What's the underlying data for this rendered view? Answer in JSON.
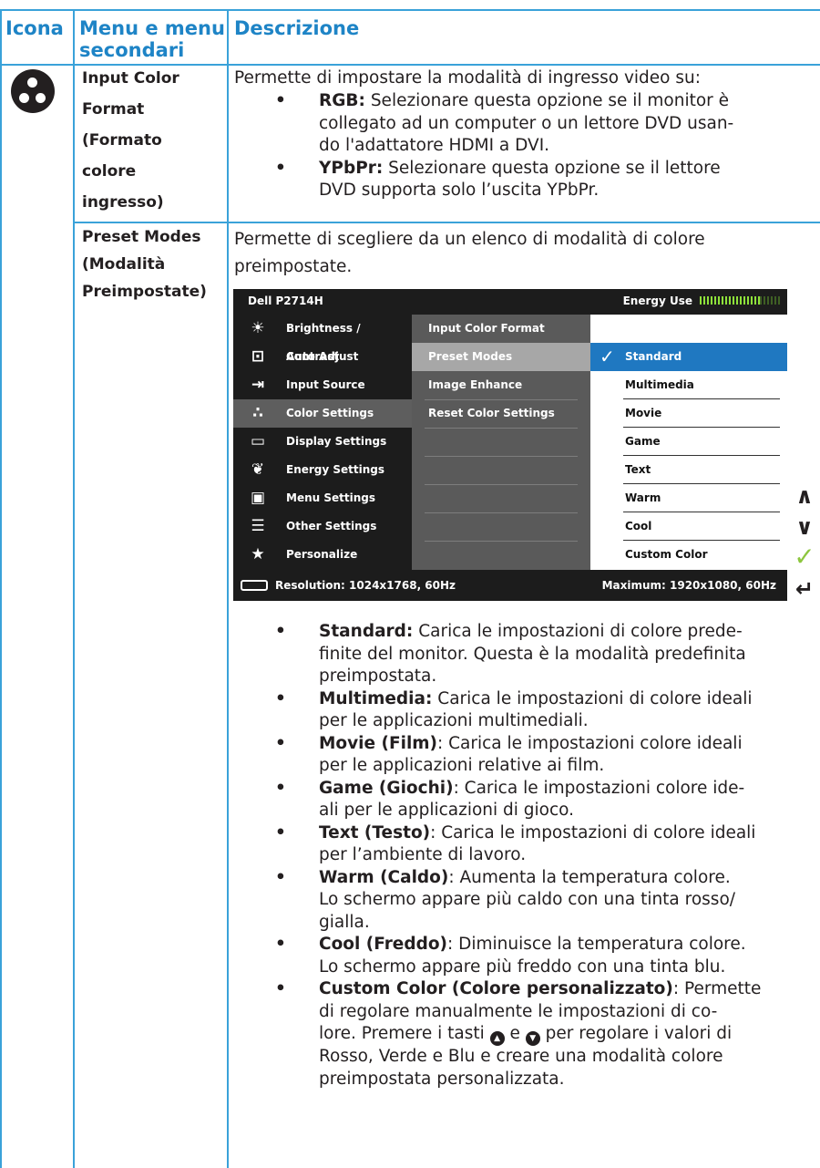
{
  "header": {
    "col_icon": "Icona",
    "col_menu_line1": "Menu e menu",
    "col_menu_line2": "secondari",
    "col_desc": "Descrizione"
  },
  "row1": {
    "icon": "color-settings-icon",
    "menu": [
      "Input Color",
      "Format",
      "(Formato",
      "colore",
      "ingresso)"
    ],
    "intro": "Permette di impostare la modalità di ingresso video su:",
    "bullets": [
      {
        "term": "RGB:",
        "text_l1": " Selezionare questa opzione se il monitor è",
        "text_l2": "collegato ad un computer o un lettore DVD usan-",
        "text_l3": "do l'adattatore HDMI a DVI."
      },
      {
        "term": "YPbPr:",
        "text_l1": " Selezionare questa opzione se il lettore",
        "text_l2": "DVD supporta solo l’uscita YPbPr."
      }
    ]
  },
  "row2": {
    "menu": [
      "Preset Modes",
      "(Modalità",
      "Preimpostate)"
    ],
    "intro_l1": "Permette di scegliere da un elenco di modalità di colore",
    "intro_l2": "preimpostate.",
    "osd": {
      "title": "Dell P2714H",
      "energy_label": "Energy Use",
      "main_menu": [
        {
          "label": "Brightness / Contrast",
          "icon": "brightness-icon"
        },
        {
          "label": "Auto Adjust",
          "icon": "auto-adjust-icon"
        },
        {
          "label": "Input Source",
          "icon": "input-source-icon"
        },
        {
          "label": "Color Settings",
          "icon": "color-settings-icon",
          "selected": true
        },
        {
          "label": "Display Settings",
          "icon": "display-icon"
        },
        {
          "label": "Energy Settings",
          "icon": "energy-icon"
        },
        {
          "label": "Menu Settings",
          "icon": "menu-icon"
        },
        {
          "label": "Other Settings",
          "icon": "other-settings-icon"
        },
        {
          "label": "Personalize",
          "icon": "star-icon"
        }
      ],
      "sub_menu": [
        "Input Color Format",
        "Preset Modes",
        "Image Enhance",
        "Reset Color Settings"
      ],
      "modes": [
        "Standard",
        "Multimedia",
        "Movie",
        "Game",
        "Text",
        "Warm",
        "Cool",
        "Custom Color"
      ],
      "selected_mode": "Standard",
      "resolution": "Resolution: 1024x1768, 60Hz",
      "maximum": "Maximum: 1920x1080, 60Hz",
      "side_buttons": [
        "up-arrow-icon",
        "down-arrow-icon",
        "check-icon",
        "back-icon"
      ]
    },
    "bullets": [
      {
        "term": "Standard:",
        "lines": [
          " Carica le impostazioni di colore prede-",
          "finite del monitor. Questa è la modalità predefinita",
          "preimpostata."
        ]
      },
      {
        "term": "Multimedia:",
        "lines": [
          " Carica le impostazioni di colore ideali",
          "per le applicazioni multimediali."
        ]
      },
      {
        "term": "Movie (Film)",
        "lines": [
          ": Carica le impostazioni colore ideali",
          "per le applicazioni relative ai film."
        ]
      },
      {
        "term": "Game (Giochi)",
        "lines": [
          ": Carica le impostazioni colore ide-",
          "ali per le applicazioni di gioco."
        ]
      },
      {
        "term": "Text (Testo)",
        "lines": [
          ": Carica le impostazioni di colore ideali",
          "per l’ambiente di lavoro."
        ]
      },
      {
        "term": "Warm (Caldo)",
        "lines": [
          ": Aumenta la temperatura colore.",
          "Lo schermo appare più caldo con una tinta rosso/",
          "gialla."
        ]
      },
      {
        "term": "Cool (Freddo)",
        "lines": [
          ": Diminuisce la temperatura colore.",
          "Lo schermo appare più freddo con una tinta blu."
        ]
      },
      {
        "term": "Custom Color (Colore personalizzato)",
        "lines": [
          ": Permette",
          "di regolare manualmente le impostazioni di co-"
        ]
      }
    ],
    "custom_l3a": "lore. Premere i tasti ",
    "custom_l3b": " e ",
    "custom_l3c": " per regolare i valori di",
    "custom_l4": "Rosso, Verde e Blu e creare una modalità colore",
    "custom_l5": "preimpostata personalizzata."
  },
  "colors": {
    "accent": "#1e84c6",
    "rule": "#3aa2d9",
    "osd_bg": "#1c1c1c",
    "osd_sel": "#1f78c1"
  }
}
